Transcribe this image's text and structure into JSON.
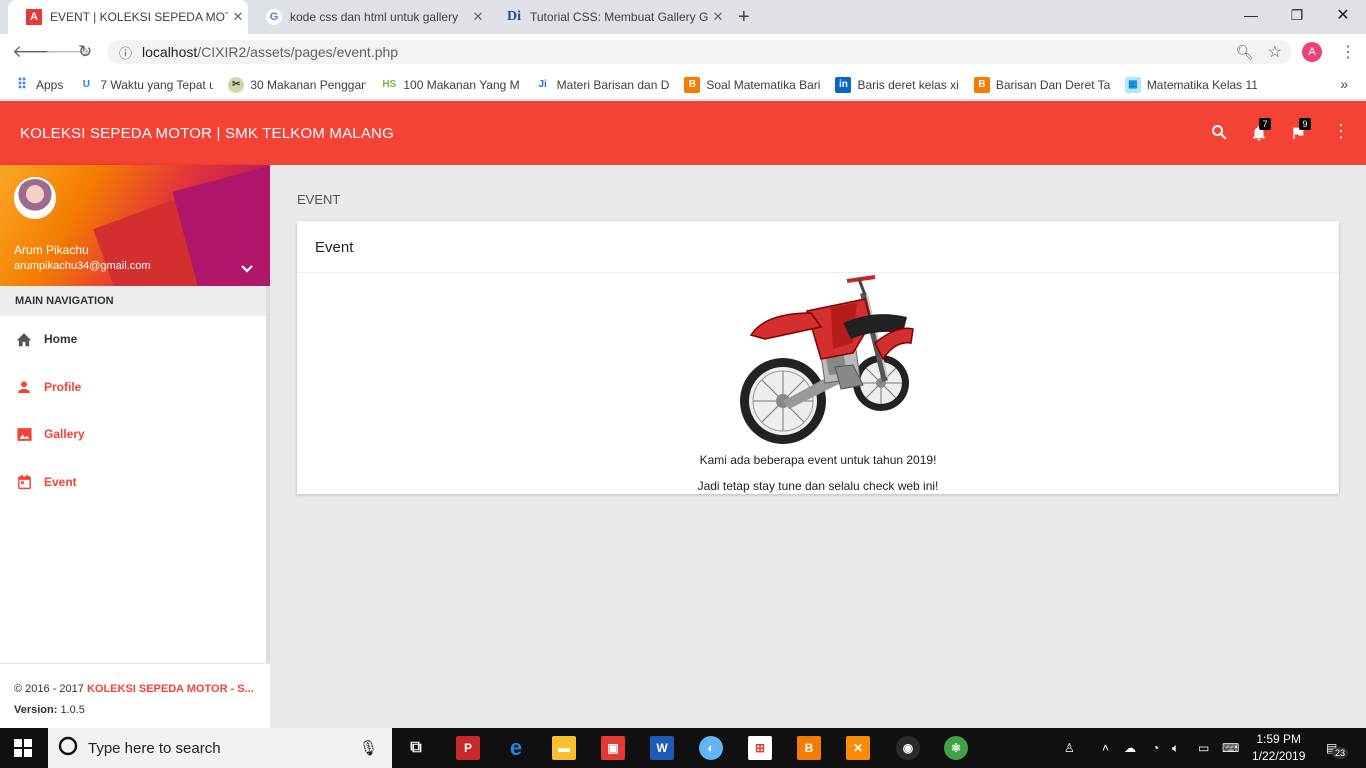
{
  "browser": {
    "tabs": [
      {
        "title": "EVENT | KOLEKSI SEPEDA MOTOR",
        "active": true
      },
      {
        "title": "kode css dan html untuk gallery",
        "active": false
      },
      {
        "title": "Tutorial CSS: Membuat Gallery G",
        "active": false
      }
    ],
    "new_tab": "+",
    "url_host": "localhost",
    "url_path": "/CIXIR2/assets/pages/event.php",
    "profile_initial": "A",
    "bookmarks": [
      "Apps",
      "7 Waktu yang Tepat u",
      "30 Makanan Penggan",
      "100 Makanan Yang M",
      "Materi Barisan dan D",
      "Soal Matematika Bari",
      "Baris deret kelas xi",
      "Barisan Dan Deret Ta",
      "Matematika Kelas 11"
    ],
    "bookmarks_more": "»"
  },
  "app": {
    "brand": "KOLEKSI SEPEDA MOTOR | SMK TELKOM MALANG",
    "notifications_count": "7",
    "flags_count": "9",
    "accent": "#f44336"
  },
  "user": {
    "name": "Arum Pikachu",
    "email": "arumpikachu34@gmail.com"
  },
  "sidebar": {
    "header": "MAIN NAVIGATION",
    "items": [
      {
        "label": "Home",
        "icon": "home-icon",
        "color": "#333333"
      },
      {
        "label": "Profile",
        "icon": "person-icon",
        "color": "#f44336"
      },
      {
        "label": "Gallery",
        "icon": "image-icon",
        "color": "#f44336"
      },
      {
        "label": "Event",
        "icon": "calendar-icon",
        "color": "#f44336"
      }
    ],
    "footer_copy": "© 2016 - 2017 ",
    "footer_brand": "KOLEKSI SEPEDA MOTOR - S...",
    "version_label": "Version:",
    "version_value": " 1.0.5"
  },
  "main": {
    "breadcrumb": "EVENT",
    "card_title": "Event",
    "line1": "Kami ada beberapa event untuk tahun 2019!",
    "line2": "Jadi tetap stay tune dan selalu check web ini!"
  },
  "taskbar": {
    "search_placeholder": "Type here to search",
    "time": "1:59 PM",
    "date": "1/22/2019",
    "notif_count": "23"
  }
}
